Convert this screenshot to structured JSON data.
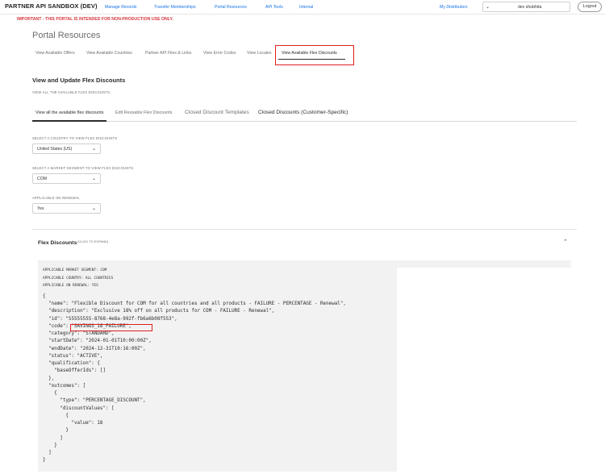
{
  "header": {
    "brand": "PARTNER API SANDBOX (DEV)",
    "nav": [
      "Manage Records",
      "Transfer Memberships",
      "Portal Resources",
      "API Tools",
      "Internal"
    ],
    "my_distributors": "My Distributors",
    "user": "dev shubhita",
    "logout": "Logout"
  },
  "warning": "IMPORTANT - THIS PORTAL IS INTENDED FOR NON-PRODUCTION USE ONLY.",
  "page": {
    "title": "Portal Resources",
    "subtabs": [
      "View Available Offers",
      "View Available Countries",
      "Partner API Files & Links",
      "View Error Codes",
      "View Locales",
      "View Available Flex Discounts"
    ]
  },
  "section": {
    "title": "View and Update Flex Discounts",
    "subtitle": "VIEW ALL THE AVAILABLE FLEX DISCOUNTS.",
    "inner_tabs": [
      "View all the available flex discounts",
      "Edit Reusable Flex Discounts",
      "Closed Discount Templates",
      "Closed Discounts (Customer-Specific)"
    ]
  },
  "filters": {
    "country": {
      "label": "SELECT A COUNTRY TO VIEW FLEX DISCOUNTS",
      "value": "United States (US)"
    },
    "segment": {
      "label": "SELECT A MARKET SEGMENT TO VIEW FLEX DISCOUNTS",
      "value": "COM"
    },
    "renewal": {
      "label": "APPLICABLE ON RENEWAL",
      "value": "Yes"
    }
  },
  "panel": {
    "title": "Flex Discounts",
    "hint": "(CLICK TO EXPAND)",
    "meta": [
      "APPLICABLE MARKET SEGMENT: COM",
      "APPLICABLE COUNTRY: ALL COUNTRIES",
      "APPLICABLE ON RENEWAL: YES"
    ],
    "json_lines": [
      "{",
      "  \"name\": \"Flexible Discount for COM for all countries and all products - FAILURE - PERCENTAGE - Renewal\",",
      "  \"description\": \"Exclusive 18% off on all products for COM - FAILURE - Renewal\",",
      "  \"id\": \"55555555-8768-4e8a-992f-fb6a6b08f553\",",
      "  \"code\": \"SAVINGS_18_FAILURE\",",
      "  \"category\": \"STANDARD\",",
      "  \"startDate\": \"2024-01-01T10:00:00Z\",",
      "  \"endDate\": \"2024-12-31T10:16:00Z\",",
      "  \"status\": \"ACTIVE\",",
      "  \"qualification\": {",
      "    \"baseOfferIds\": []",
      "  },",
      "  \"outcomes\": [",
      "    {",
      "      \"type\": \"PERCENTAGE_DISCOUNT\",",
      "      \"discountValues\": [",
      "        {",
      "          \"value\": 18",
      "        }",
      "      ]",
      "    }",
      "  ]",
      "}"
    ]
  },
  "icons": {
    "dropdown": "chevron-down-icon",
    "collapse": "chevron-up-icon"
  },
  "colors": {
    "link": "#1473e6",
    "warning": "#d7373f",
    "highlight_box": "#e02020",
    "code_bg": "#f2f2f2"
  }
}
